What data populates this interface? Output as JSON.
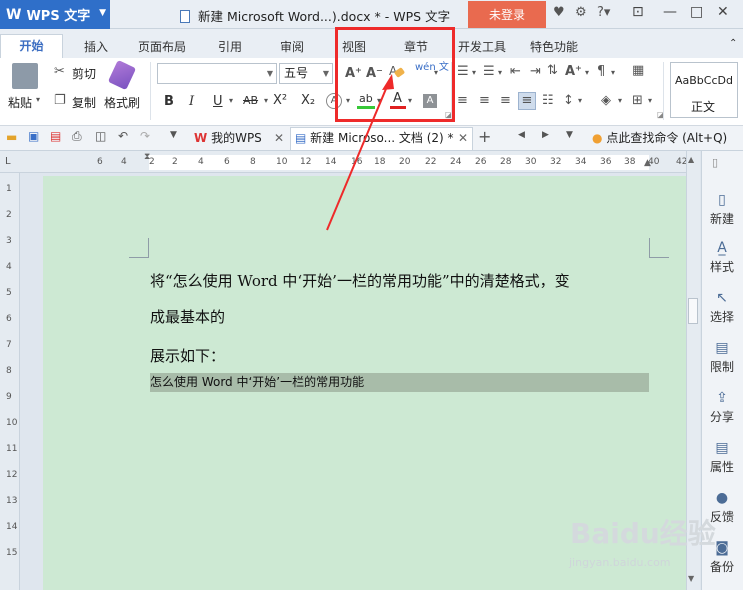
{
  "app": {
    "name": "WPS 文字",
    "logo": "W"
  },
  "window": {
    "title": "新建 Microsoft Word...).docx * - WPS 文字",
    "login_label": "未登录"
  },
  "tabs": [
    "开始",
    "插入",
    "页面布局",
    "引用",
    "审阅",
    "视图",
    "章节",
    "开发工具",
    "特色功能"
  ],
  "ribbon": {
    "clipboard": {
      "paste": "粘贴",
      "cut": "剪切",
      "copy": "复制",
      "format_painter": "格式刷"
    },
    "font": {
      "font_name": "",
      "font_size": "五号",
      "bold": "B",
      "italic": "I",
      "underline": "U",
      "strike": "AB",
      "superscript": "X²",
      "subscript": "X₂",
      "grow": "A⁺",
      "shrink": "A⁻",
      "pinyin": "wén 文",
      "color_char": "A"
    },
    "style": {
      "preview": "AaBbCcDd",
      "name": "正文"
    }
  },
  "doc_tabs": [
    {
      "label": "我的WPS"
    },
    {
      "label": "新建 Microso... 文档 (2) *"
    }
  ],
  "search_command": "点此查找命令 (Alt+Q)",
  "ruler": {
    "h_numbers": [
      "6",
      "4",
      "2",
      "2",
      "4",
      "6",
      "8",
      "10",
      "12",
      "14",
      "16",
      "18",
      "20",
      "22",
      "24",
      "26",
      "28",
      "30",
      "32",
      "34",
      "36",
      "38",
      "40",
      "42"
    ],
    "v_numbers": [
      "1",
      "2",
      "3",
      "4",
      "5",
      "6",
      "7",
      "8",
      "9",
      "10",
      "11",
      "12",
      "13",
      "14",
      "15"
    ]
  },
  "document": {
    "line1": "将“怎么使用 Word 中‘开始’一栏的常用功能”中的清楚格式，变",
    "line2": "成最基本的",
    "line3": "展示如下：",
    "highlighted": "怎么使用 Word 中‘开始’一栏的常用功能"
  },
  "panel": [
    "新建",
    "样式",
    "选择",
    "限制",
    "分享",
    "属性",
    "反馈",
    "备份"
  ],
  "watermark": {
    "main": "Baidu经验",
    "sub": "jingyan.baidu.com"
  },
  "colors": {
    "accent": "#2f6fc9",
    "login": "#e96a4f",
    "page_bg": "#cde9d3",
    "highlight": "#a8bca9",
    "annotation": "#ee2a2a"
  }
}
